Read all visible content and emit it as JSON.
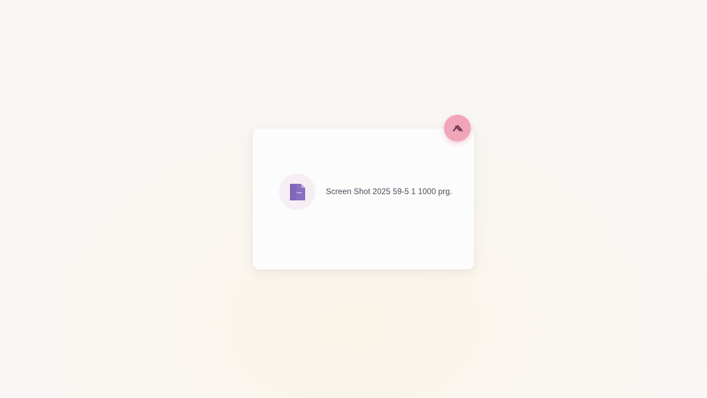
{
  "file_card": {
    "file_name": "Screen Shot 2025 59-5 1  1000 prg.",
    "file_icon": "document-icon",
    "close_icon": "close-icon"
  },
  "colors": {
    "close_button": "#f0a6b8",
    "file_icon": "#8a6fc0",
    "icon_badge": "#f6eef5",
    "card": "#fdfcfc"
  }
}
